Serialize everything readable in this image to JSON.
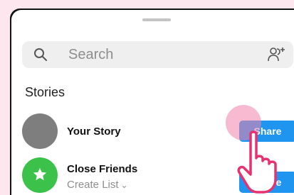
{
  "search": {
    "placeholder": "Search",
    "search_icon": "search-icon",
    "add_people_icon": "add-people-icon"
  },
  "stories_section": {
    "title": "Stories"
  },
  "rows": [
    {
      "name": "Your Story",
      "button_label": "Share",
      "avatar_color": "#7e7e7e"
    },
    {
      "name": "Close Friends",
      "subtitle": "Create List",
      "button_label": "Share",
      "avatar_color": "#3cc24b",
      "avatar_icon": "star-icon",
      "subtitle_icon": "chevron-down-icon"
    }
  ],
  "colors": {
    "background": "#fde6ee",
    "accent": "#1f95f0",
    "tap_highlight": "#f082aa",
    "hand_outline": "#e8316f"
  },
  "overlay": {
    "pointer_icon": "hand-pointer-icon"
  }
}
